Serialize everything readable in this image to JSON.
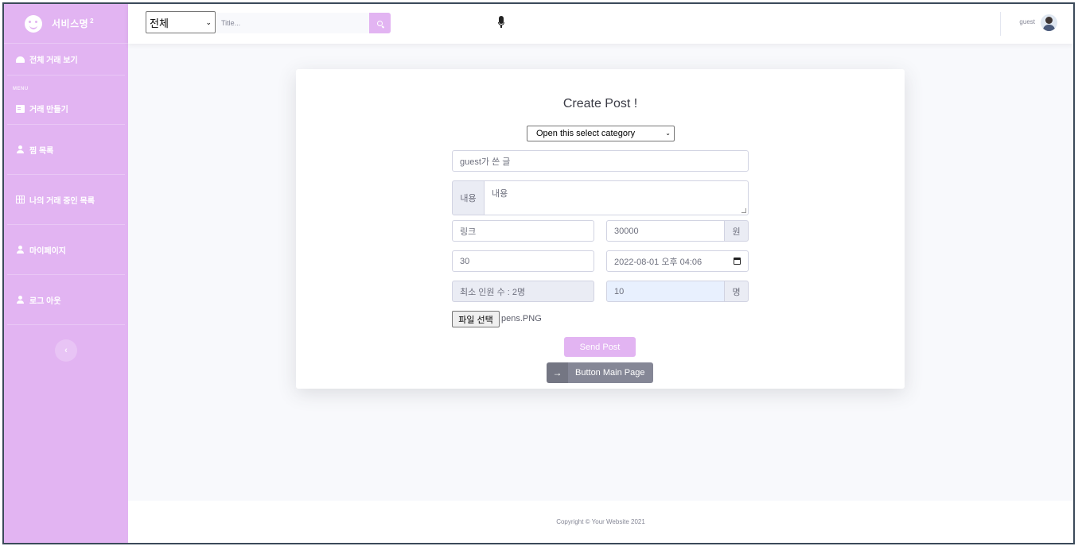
{
  "brand": {
    "name": "서비스명",
    "sup": "2"
  },
  "sidebar": {
    "heading": "MENU",
    "items": [
      {
        "label": "전체 거래 보기",
        "icon": "dashboard-icon"
      },
      {
        "label": "거래 만들기",
        "icon": "card-icon"
      },
      {
        "label": "찜 목록",
        "icon": "user-icon"
      },
      {
        "label": "나의 거래 중인 목록",
        "icon": "table-icon"
      },
      {
        "label": "마이페이지",
        "icon": "user-icon"
      },
      {
        "label": "로그 아웃",
        "icon": "user-icon"
      }
    ],
    "toggle_glyph": "‹"
  },
  "topbar": {
    "category_value": "전체",
    "search_placeholder": "Title...",
    "user_name": "guest"
  },
  "form": {
    "title": "Create Post !",
    "category_value": "Open this select category",
    "title_value": "guest가 쓴 글",
    "content_addon": "내용",
    "content_value": "내용",
    "link_placeholder": "링크",
    "price_value": "30000",
    "price_addon": "원",
    "days_value": "30",
    "date_value": "2022-08-01 오후 04:06",
    "min_people_value": "최소 인원 수 : 2명",
    "people_value": "10",
    "people_addon": "명",
    "file_button": "파일 선택",
    "file_name": "pens.PNG",
    "send_label": "Send Post",
    "main_label": "Button Main Page",
    "main_arrow": "→"
  },
  "footer": {
    "copyright": "Copyright © Your Website 2021"
  },
  "colors": {
    "sidebar": "#e2b4f2",
    "accent": "#e2b4f2",
    "secondary": "#858796"
  }
}
